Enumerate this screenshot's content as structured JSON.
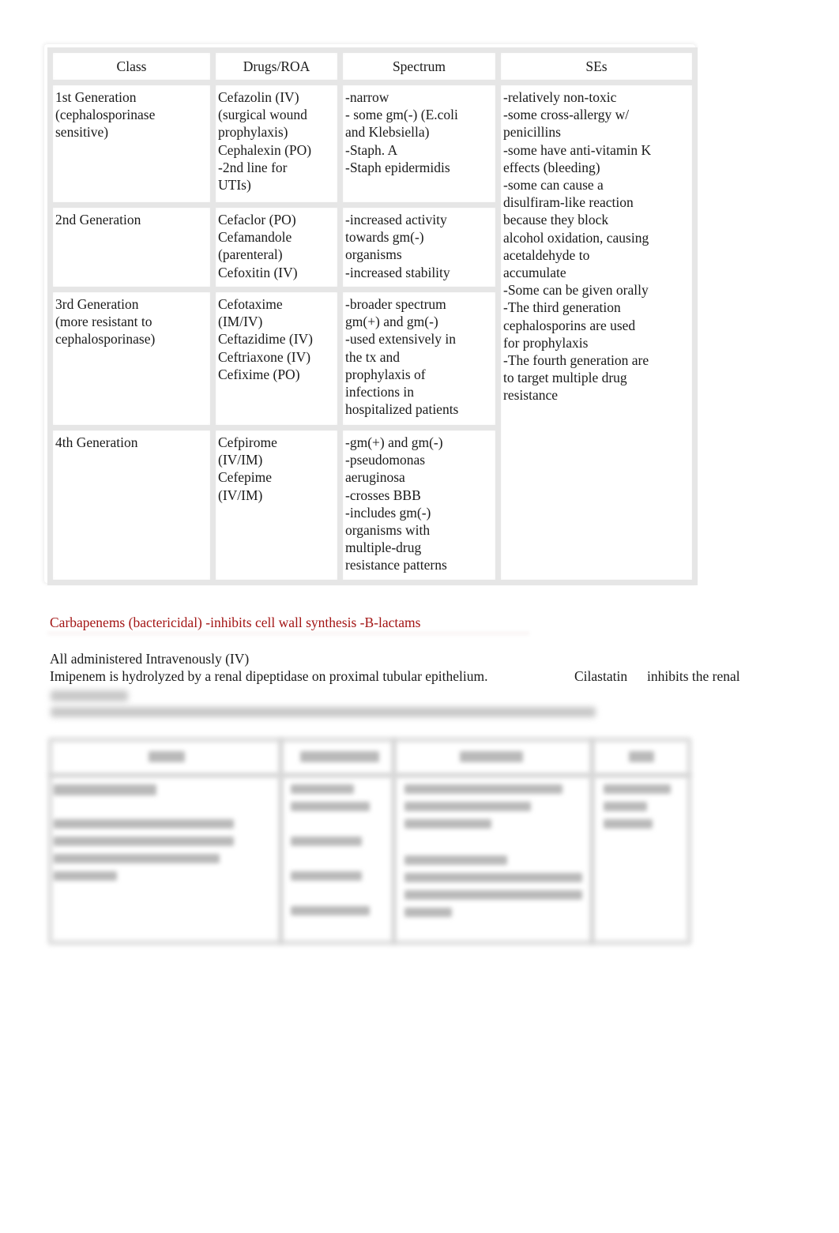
{
  "cephalosporin_table": {
    "headers": [
      "Class",
      "Drugs/ROA",
      "Spectrum",
      "SEs"
    ],
    "rows": [
      {
        "class": [
          "1st Generation",
          "(cephalosporinase",
          "sensitive)"
        ],
        "drugs": [
          "Cefazolin (IV)",
          "(surgical wound",
          "prophylaxis)",
          "Cephalexin (PO)",
          "-2nd line for",
          "UTIs)"
        ],
        "spectrum": [
          "-narrow",
          "- some gm(-) (E.coli",
          "and Klebsiella)",
          "-Staph. A",
          "-Staph epidermidis"
        ]
      },
      {
        "class": [
          "2nd Generation"
        ],
        "drugs": [
          "Cefaclor (PO)",
          "Cefamandole",
          "(parenteral)",
          "Cefoxitin (IV)"
        ],
        "spectrum": [
          "-increased activity",
          "towards gm(-)",
          "organisms",
          "-increased stability"
        ]
      },
      {
        "class": [
          "3rd Generation",
          "(more resistant to",
          "cephalosporinase)"
        ],
        "drugs": [
          "Cefotaxime",
          "(IM/IV)",
          "Ceftazidime (IV)",
          "Ceftriaxone (IV)",
          "Cefixime (PO)"
        ],
        "spectrum": [
          "-broader spectrum",
          "gm(+) and gm(-)",
          "-used extensively in",
          "the tx and",
          "prophylaxis of",
          "infections in",
          "hospitalized patients"
        ]
      },
      {
        "class": [
          "4th Generation"
        ],
        "drugs": [
          "Cefpirome",
          "(IV/IM)",
          "Cefepime",
          "(IV/IM)"
        ],
        "spectrum": [
          "-gm(+) and gm(-)",
          "-pseudomonas",
          "aeruginosa",
          "-crosses BBB",
          "-includes gm(-)",
          "organisms with",
          "multiple-drug",
          "resistance patterns"
        ]
      }
    ],
    "side_effects": [
      "-relatively non-toxic",
      "-some cross-allergy w/",
      "penicillins",
      "-some have anti-vitamin K",
      "effects (bleeding)",
      "-some can cause a",
      "disulfiram-like reaction",
      "because they block",
      "alcohol oxidation, causing",
      "acetaldehyde to",
      "accumulate",
      "-Some can be given orally",
      "-The third generation",
      "cephalosporins are used",
      "for prophylaxis",
      "-The fourth generation are",
      "to target multiple drug",
      "resistance"
    ]
  },
  "carbapenems": {
    "heading": "Carbapenems (bactericidal) -inhibits cell wall synthesis -B-lactams",
    "heading_color": "#a31515",
    "line1": "All administered Intravenously (IV)",
    "line2": "Imipenem is hydrolyzed by a renal dipeptidase on proximal tubular epithelium.",
    "line2_term": "Cilastatin",
    "line2_tail": "inhibits the renal"
  }
}
